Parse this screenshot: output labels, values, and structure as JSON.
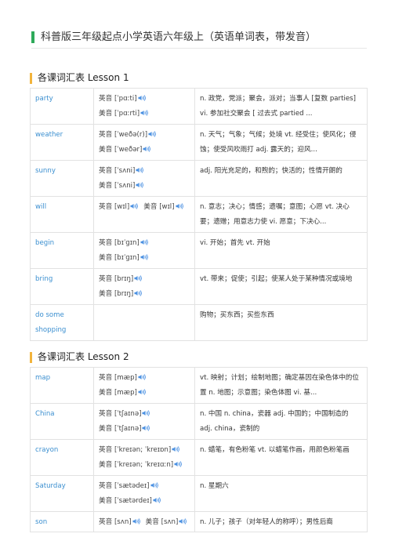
{
  "header": {
    "title": "科普版三年级起点小学英语六年级上（英语单词表，带发音）",
    "accent_color": "#2eaa5a"
  },
  "labels": {
    "uk": "英音",
    "us": "美音"
  },
  "icons": {
    "speaker": "speaker-icon"
  },
  "sections": [
    {
      "title": "各课词汇表 Lesson 1",
      "rows": [
        {
          "word": "party",
          "uk": "[ˈpɑːti]",
          "us": "[ˈpɑːrti]",
          "meaning": "n. 政党，党派；聚会，派对；当事人 [复数 parties] vi. 参加社交聚会 [ 过去式 partied ..."
        },
        {
          "word": "weather",
          "uk": "[ˈweðə(r)]",
          "us": "[ˈweðər]",
          "meaning": "n. 天气；气象；气候；处境 vt. 经受住；使风化；侵蚀；使受风吹雨打 adj. 露天的；迎风..."
        },
        {
          "word": "sunny",
          "uk": "[ˈsʌni]",
          "us": "[ˈsʌni]",
          "meaning": "adj. 阳光充足的，和煦的；快活的；性情开朗的"
        },
        {
          "word": "will",
          "uk": "[wɪl]",
          "us": "[wɪl]",
          "inline": true,
          "meaning": "n. 意志；决心；情感；遗嘱；意图；心愿 vt. 决心要；遗赠；用意志力使 vi. 愿意；下决心..."
        },
        {
          "word": "begin",
          "uk": "[bɪˈɡɪn]",
          "us": "[bɪˈɡɪn]",
          "meaning": "vi. 开始；首先 vt. 开始"
        },
        {
          "word": "bring",
          "uk": "[brɪŋ]",
          "us": "[brɪŋ]",
          "meaning": "vt. 带来；促使；引起；使某人处于某种情况或境地"
        },
        {
          "word": "do some shopping",
          "uk": "",
          "us": "",
          "meaning": "购物；买东西；买些东西"
        }
      ]
    },
    {
      "title": "各课词汇表 Lesson 2",
      "rows": [
        {
          "word": "map",
          "uk": "[mæp]",
          "us": "[mæp]",
          "meaning": "vt. 映射；计划；绘制地图；确定基因在染色体中的位置 n. 地图；示意图；染色体图 vi. 基..."
        },
        {
          "word": "China",
          "uk": "[ˈtʃaɪnə]",
          "us": "[ˈtʃaɪnə]",
          "meaning": "n. 中国 n. china，瓷器 adj. 中国的；中国制造的 adj. china，瓷制的"
        },
        {
          "word": "crayon",
          "uk": "[ˈkreɪən; ˈkreɪɒn]",
          "us": "[ˈkreɪən; ˈkreɪɑːn]",
          "meaning": "n. 蜡笔，有色粉笔 vt. 以蜡笔作画，用颜色粉笔画"
        },
        {
          "word": "Saturday",
          "uk": "[ˈsætədeɪ]",
          "us": "[ˈsætərdeɪ]",
          "meaning": "n. 星期六"
        },
        {
          "word": "son",
          "uk": "[sʌn]",
          "us": "[sʌn]",
          "inline": true,
          "meaning": "n. 儿子；孩子（对年轻人的称呼）；男性后裔"
        }
      ]
    }
  ]
}
